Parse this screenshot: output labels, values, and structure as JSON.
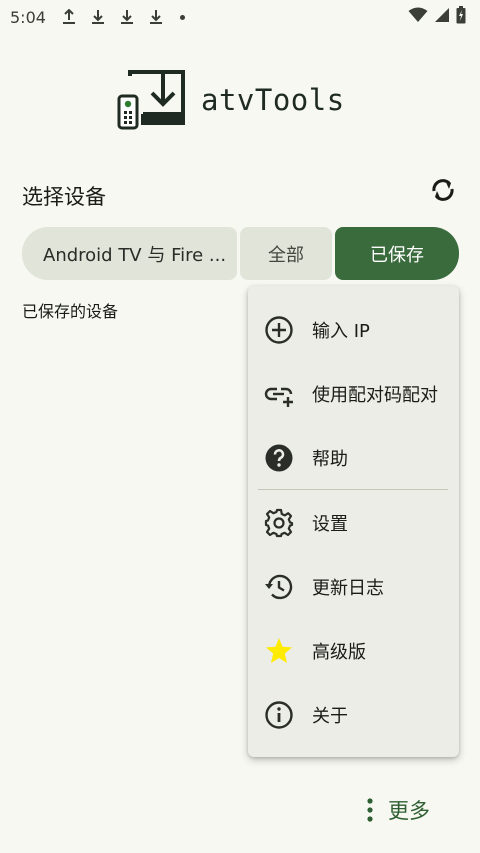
{
  "status_bar": {
    "time": "5:04"
  },
  "app": {
    "name": "atvTools"
  },
  "device_section": {
    "title": "选择设备",
    "filters": [
      {
        "label": "Android TV 与 Fire ..."
      },
      {
        "label": "全部"
      },
      {
        "label": "已保存",
        "selected": true
      }
    ],
    "saved_devices_label": "已保存的设备"
  },
  "menu": {
    "items": [
      {
        "label": "输入 IP",
        "icon": "add-circle-icon"
      },
      {
        "label": "使用配对码配对",
        "icon": "link-add-icon"
      },
      {
        "label": "帮助",
        "icon": "help-icon"
      },
      {
        "label": "设置",
        "icon": "gear-icon"
      },
      {
        "label": "更新日志",
        "icon": "history-icon"
      },
      {
        "label": "高级版",
        "icon": "star-icon"
      },
      {
        "label": "关于",
        "icon": "info-icon"
      }
    ]
  },
  "footer": {
    "more_label": "更多"
  },
  "colors": {
    "accent": "#3a6b3d",
    "background": "#f6f8f1",
    "chip": "#e1e4d9",
    "menu_bg": "#ebede6",
    "star": "#ffeb00"
  }
}
